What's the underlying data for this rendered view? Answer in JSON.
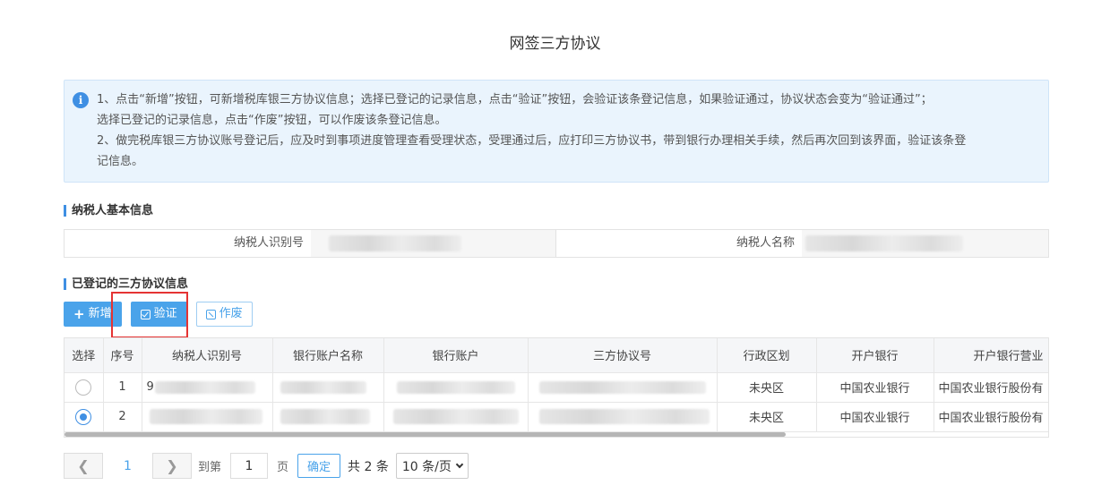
{
  "page": {
    "title": "网签三方协议"
  },
  "notice": {
    "icon": "info-icon",
    "line1": "1、点击“新增”按钮，可新增税库银三方协议信息；选择已登记的记录信息，点击“验证”按钮，会验证该条登记信息，如果验证通过，协议状态会变为“验证通过”；",
    "line1b": "选择已登记的记录信息，点击“作废”按钮，可以作废该条登记信息。",
    "line2": "2、做完税库银三方协议账号登记后，应及时到事项进度管理查看受理状态，受理通过后，应打印三方协议书，带到银行办理相关手续，然后再次回到该界面，验证该条登",
    "line2b": "记信息。"
  },
  "basic": {
    "section_title": "纳税人基本信息",
    "id_label": "纳税人识别号",
    "name_label": "纳税人名称"
  },
  "agreements": {
    "section_title": "已登记的三方协议信息",
    "add_label": "新增",
    "verify_label": "验证",
    "void_label": "作废",
    "columns": [
      "选择",
      "序号",
      "纳税人识别号",
      "银行账户名称",
      "银行账户",
      "三方协议号",
      "行政区划",
      "开户银行",
      "开户银行营业"
    ],
    "rows": [
      {
        "seq": "1",
        "id_prefix": "9",
        "region": "未央区",
        "bank": "中国农业银行",
        "branch": "中国农业银行股份有",
        "selected": false
      },
      {
        "seq": "2",
        "id_prefix": "",
        "region": "未央区",
        "bank": "中国农业银行",
        "branch": "中国农业银行股份有",
        "selected": true
      }
    ]
  },
  "pager": {
    "current": "1",
    "goto_label": "到第",
    "page_input": "1",
    "page_unit": "页",
    "ok_label": "确定",
    "total": "共 2 条",
    "page_size": "10 条/页"
  },
  "colors": {
    "accent": "#4aa3ea",
    "highlight": "#e53333",
    "notice_bg": "#eaf4fd"
  }
}
